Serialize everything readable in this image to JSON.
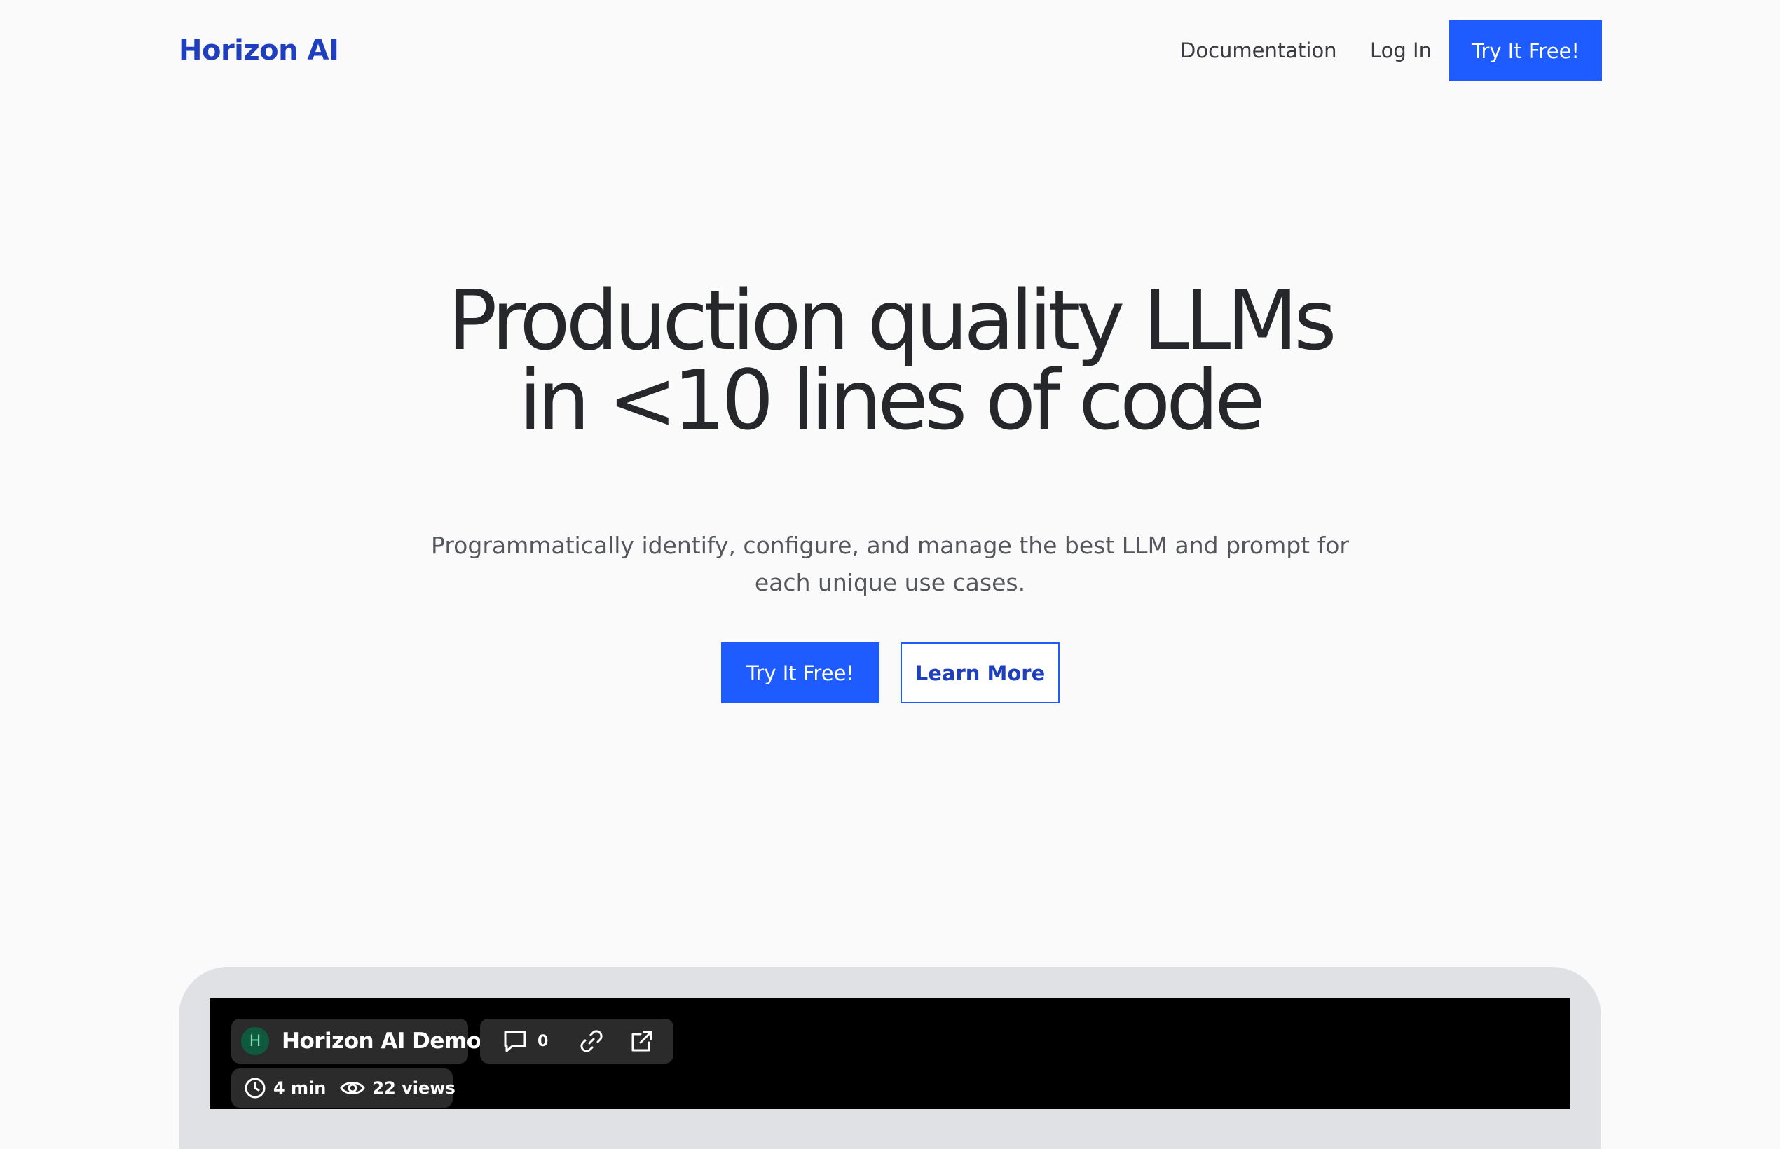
{
  "header": {
    "logo": "Horizon AI",
    "nav": {
      "documentation": "Documentation",
      "login": "Log In",
      "cta": "Try It Free!"
    }
  },
  "hero": {
    "title_line1": "Production quality LLMs",
    "title_line2": "in <10 lines of code",
    "subtitle_line1": "Programmatically identify, configure, and manage the best LLM and prompt for",
    "subtitle_line2": "each unique use cases.",
    "primary_button": "Try It Free!",
    "secondary_button": "Learn More"
  },
  "video": {
    "avatar_letter": "H",
    "title": "Horizon AI Demo",
    "comment_count": "0",
    "duration": "4 min",
    "views": "22 views",
    "icons": {
      "comment": "comment-icon",
      "link": "link-icon",
      "external": "external-link-icon",
      "clock": "clock-icon",
      "views": "eye-icon"
    }
  },
  "colors": {
    "brand": "#1f3fbf",
    "accent": "#1f5cff",
    "background": "#fafafa",
    "frame": "#dfe1e5",
    "player": "#000000"
  }
}
